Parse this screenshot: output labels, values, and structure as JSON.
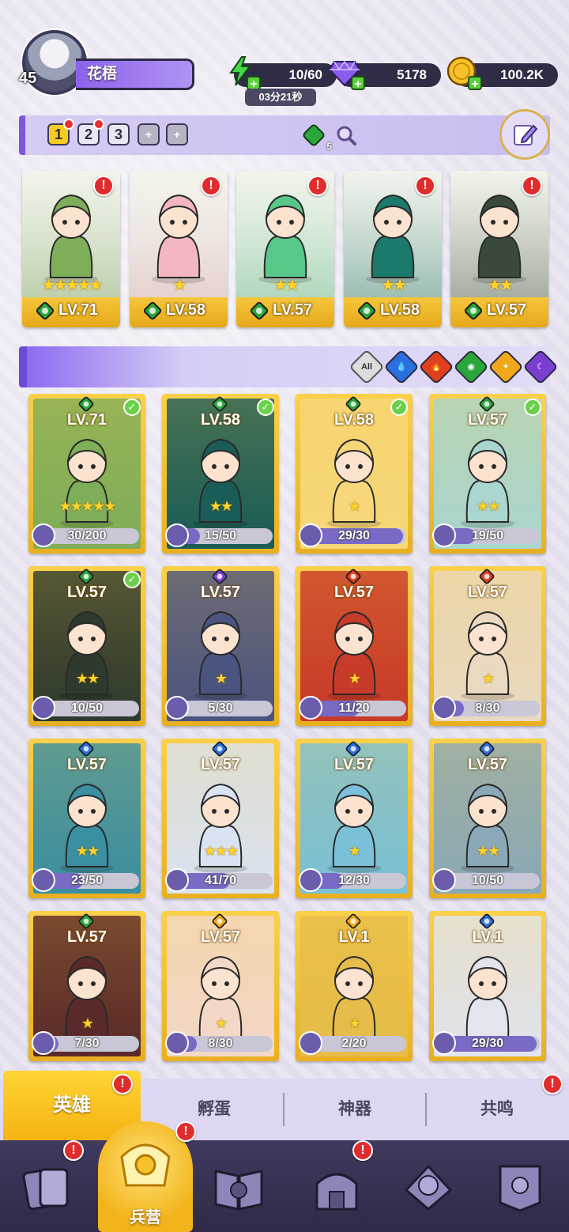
{
  "player": {
    "level": "45",
    "name": "花梧"
  },
  "resources": {
    "energy": "10/60",
    "energy_timer": "03分21秒",
    "gems": "5178",
    "gold": "100.2K"
  },
  "team_tabs": [
    "1",
    "2",
    "3",
    "+",
    "+"
  ],
  "team_gem_count": "5",
  "colors": {
    "accent": "#7a58d9",
    "gold": "#f4b312",
    "alert": "#e02c2c",
    "earth": "#2aa63a",
    "water": "#2a6fe0",
    "fire": "#e0401e",
    "light": "#f0a81a",
    "dark": "#7a3fd0"
  },
  "team": [
    {
      "level": "LV.71",
      "stars": "★★★★★",
      "element": "earth-icon",
      "art": "#7fae5a"
    },
    {
      "level": "LV.58",
      "stars": "★",
      "element": "earth-icon",
      "art": "#f4b7c2"
    },
    {
      "level": "LV.57",
      "stars": "★★",
      "element": "earth-icon",
      "art": "#58c88a"
    },
    {
      "level": "LV.58",
      "stars": "★★",
      "element": "earth-icon",
      "art": "#1c7a6a"
    },
    {
      "level": "LV.57",
      "stars": "★★",
      "element": "earth-icon",
      "art": "#3a4a3a"
    }
  ],
  "filters": [
    "All",
    "water",
    "fire",
    "earth",
    "light",
    "dark"
  ],
  "heroes": [
    {
      "level": "LV.71",
      "element": "earth",
      "checked": true,
      "stars": "★★★★★",
      "shards": "30/200",
      "fill": 0.15,
      "art": "#7fae5a"
    },
    {
      "level": "LV.58",
      "element": "earth",
      "checked": true,
      "stars": "★★",
      "shards": "15/50",
      "fill": 0.3,
      "art": "#1a5c58"
    },
    {
      "level": "LV.58",
      "element": "earth",
      "checked": true,
      "stars": "★",
      "shards": "29/30",
      "fill": 0.97,
      "art": "#f7d77a"
    },
    {
      "level": "LV.57",
      "element": "earth",
      "checked": true,
      "stars": "★★",
      "shards": "19/50",
      "fill": 0.38,
      "art": "#a9d6cf"
    },
    {
      "level": "LV.57",
      "element": "earth",
      "checked": true,
      "stars": "★★",
      "shards": "10/50",
      "fill": 0.2,
      "art": "#2e3a2e"
    },
    {
      "level": "LV.57",
      "element": "dark",
      "checked": false,
      "stars": "★",
      "shards": "5/30",
      "fill": 0.17,
      "art": "#4a5480"
    },
    {
      "level": "LV.57",
      "element": "fire",
      "checked": false,
      "stars": "★",
      "shards": "11/20",
      "fill": 0.55,
      "art": "#c83a2a"
    },
    {
      "level": "LV.57",
      "element": "fire",
      "checked": false,
      "stars": "★",
      "shards": "8/30",
      "fill": 0.27,
      "art": "#e9d9c0"
    },
    {
      "level": "LV.57",
      "element": "water",
      "checked": false,
      "stars": "★★",
      "shards": "23/50",
      "fill": 0.46,
      "art": "#3a8fa2"
    },
    {
      "level": "LV.57",
      "element": "water",
      "checked": false,
      "stars": "★★★",
      "shards": "41/70",
      "fill": 0.59,
      "art": "#d9e3f2"
    },
    {
      "level": "LV.57",
      "element": "water",
      "checked": false,
      "stars": "★",
      "shards": "12/30",
      "fill": 0.4,
      "art": "#7ac0d8"
    },
    {
      "level": "LV.57",
      "element": "water",
      "checked": false,
      "stars": "★★",
      "shards": "10/50",
      "fill": 0.2,
      "art": "#8aa9b8"
    },
    {
      "level": "LV.57",
      "element": "earth",
      "checked": false,
      "stars": "★",
      "shards": "7/30",
      "fill": 0.23,
      "art": "#5a2a2a"
    },
    {
      "level": "LV.57",
      "element": "light",
      "checked": false,
      "stars": "★",
      "shards": "8/30",
      "fill": 0.27,
      "art": "#f3d8c8"
    },
    {
      "level": "LV.1",
      "element": "light",
      "checked": false,
      "stars": "★",
      "shards": "2/20",
      "fill": 0.1,
      "art": "#e6bd4a"
    },
    {
      "level": "LV.1",
      "element": "water",
      "checked": false,
      "stars": "",
      "shards": "29/30",
      "fill": 0.97,
      "art": "#e2e4ee"
    }
  ],
  "subtabs": {
    "heroes": "英雄",
    "hatch": "孵蛋",
    "artifact": "神器",
    "resonance": "共鸣"
  },
  "nav": {
    "barracks": "兵营"
  }
}
